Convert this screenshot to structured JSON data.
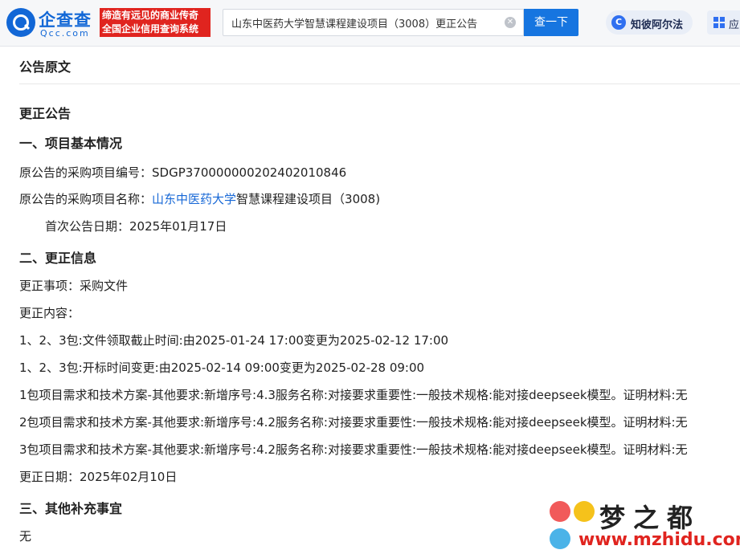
{
  "header": {
    "logo_name": "企查查",
    "logo_domain": "Qcc.com",
    "slogan_line1": "缔造有远见的商业传奇",
    "slogan_line2": "全国企业信用查询系统",
    "search_value": "山东中医药大学智慧课程建设项目（3008）更正公告",
    "search_button": "查一下",
    "ai_label": "知彼阿尔法",
    "ai_icon_glyph": "C",
    "app_label": "应"
  },
  "content": {
    "section_title": "公告原文",
    "heading": "更正公告",
    "part1_title": "一、项目基本情况",
    "project_no_label": "原公告的采购项目编号：",
    "project_no": "SDGP370000000202402010846",
    "project_name_label": "原公告的采购项目名称：",
    "project_name_link": "山东中医药大学",
    "project_name_rest": "智慧课程建设项目（3008)",
    "first_date": "首次公告日期：2025年01月17日",
    "part2_title": "二、更正信息",
    "item": "更正事项：采购文件",
    "content_label": "更正内容：",
    "changes": [
      "1、2、3包:文件领取截止时间:由2025-01-24 17:00变更为2025-02-12 17:00",
      "1、2、3包:开标时间变更:由2025-02-14 09:00变更为2025-02-28 09:00",
      "1包项目需求和技术方案-其他要求:新增序号:4.3服务名称:对接要求重要性:一般技术规格:能对接deepseek模型。证明材料:无",
      "2包项目需求和技术方案-其他要求:新增序号:4.2服务名称:对接要求重要性:一般技术规格:能对接deepseek模型。证明材料:无",
      "3包项目需求和技术方案-其他要求:新增序号:4.2服务名称:对接要求重要性:一般技术规格:能对接deepseek模型。证明材料:无"
    ],
    "change_date": "更正日期：2025年02月10日",
    "part3_title": "三、其他补充事宜",
    "part3_body": "无"
  },
  "watermark": {
    "text": "梦之都",
    "url": "www.mzhidu.com"
  }
}
